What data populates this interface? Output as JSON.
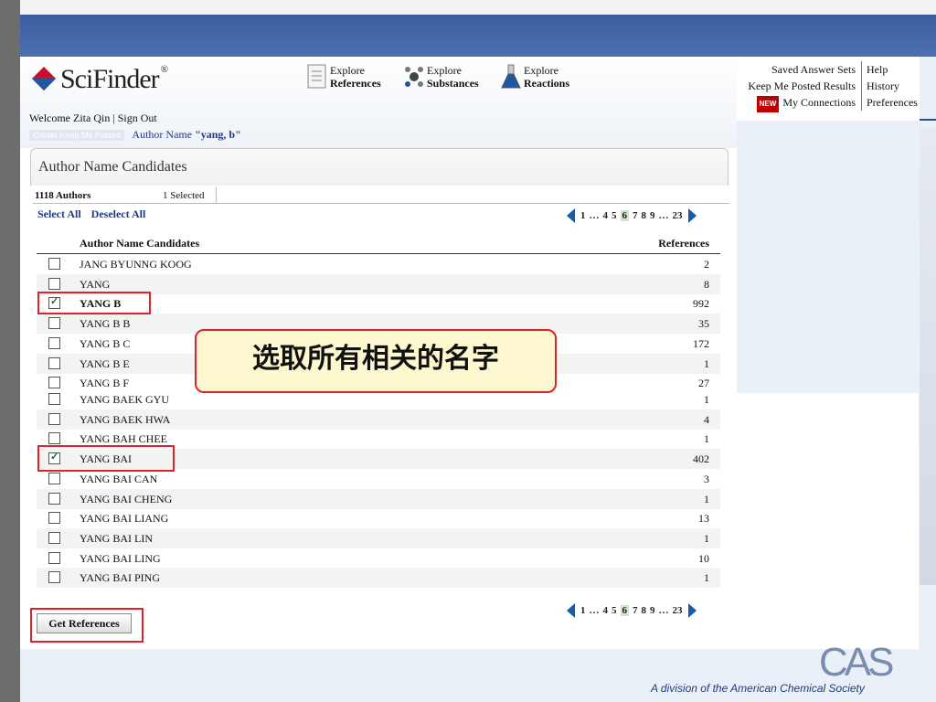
{
  "header": {
    "app_name": "SciFinder",
    "reg": "®",
    "explore": [
      {
        "small": "Explore",
        "big": "References"
      },
      {
        "small": "Explore",
        "big": "Substances"
      },
      {
        "small": "Explore",
        "big": "Reactions"
      }
    ],
    "links_left": [
      "Saved Answer Sets",
      "Keep Me Posted Results",
      "My Connections"
    ],
    "links_right": [
      "Help",
      "History",
      "Preferences"
    ],
    "new_badge": "NEW"
  },
  "session": {
    "welcome": "Welcome Zita Qin",
    "separator": "|",
    "sign_out": "Sign Out",
    "keep_me_posted": "Create Keep Me Posted",
    "crumb_label": "Author Name",
    "crumb_query": "\"yang, b\""
  },
  "panel": {
    "title": "Author Name Candidates",
    "authors_count": "1118 Authors",
    "selected_count": "1  Selected",
    "select_all": "Select All",
    "deselect_all": "Deselect All",
    "col_name": "Author Name Candidates",
    "col_refs": "References"
  },
  "pager": {
    "first": "1",
    "ellipsis1": "…",
    "pages": [
      "4",
      "5",
      "6",
      "7",
      "8",
      "9"
    ],
    "current": "6",
    "ellipsis2": "…",
    "last": "23"
  },
  "rows_top": [
    {
      "name": "JANG BYUNNG KOOG",
      "refs": "2",
      "checked": false
    },
    {
      "name": "YANG",
      "refs": "8",
      "checked": false
    },
    {
      "name": "YANG B",
      "refs": "992",
      "checked": true
    },
    {
      "name": "YANG B B",
      "refs": "35",
      "checked": false
    },
    {
      "name": "YANG B C",
      "refs": "172",
      "checked": false
    },
    {
      "name": "YANG B E",
      "refs": "1",
      "checked": false
    },
    {
      "name": "YANG B F",
      "refs": "27",
      "checked": false
    }
  ],
  "rows_bottom": [
    {
      "name": "YANG BAEK GYU",
      "refs": "1",
      "checked": false
    },
    {
      "name": "YANG BAEK HWA",
      "refs": "4",
      "checked": false
    },
    {
      "name": "YANG BAH CHEE",
      "refs": "1",
      "checked": false
    },
    {
      "name": "YANG BAI",
      "refs": "402",
      "checked": true
    },
    {
      "name": "YANG BAI CAN",
      "refs": "3",
      "checked": false
    },
    {
      "name": "YANG BAI CHENG",
      "refs": "1",
      "checked": false
    },
    {
      "name": "YANG BAI LIANG",
      "refs": "13",
      "checked": false
    },
    {
      "name": "YANG BAI LIN",
      "refs": "1",
      "checked": false
    },
    {
      "name": "YANG BAI LING",
      "refs": "10",
      "checked": false
    },
    {
      "name": "YANG BAI PING",
      "refs": "1",
      "checked": false
    }
  ],
  "callout": "选取所有相关的名字",
  "buttons": {
    "get_references": "Get References"
  },
  "footer": {
    "cas_logo": "CAS",
    "division": "A division of the American Chemical Society"
  },
  "colors": {
    "accent_red": "#e0202a",
    "link_blue": "#1a3a8a",
    "band_blue": "#3c5e9e"
  }
}
